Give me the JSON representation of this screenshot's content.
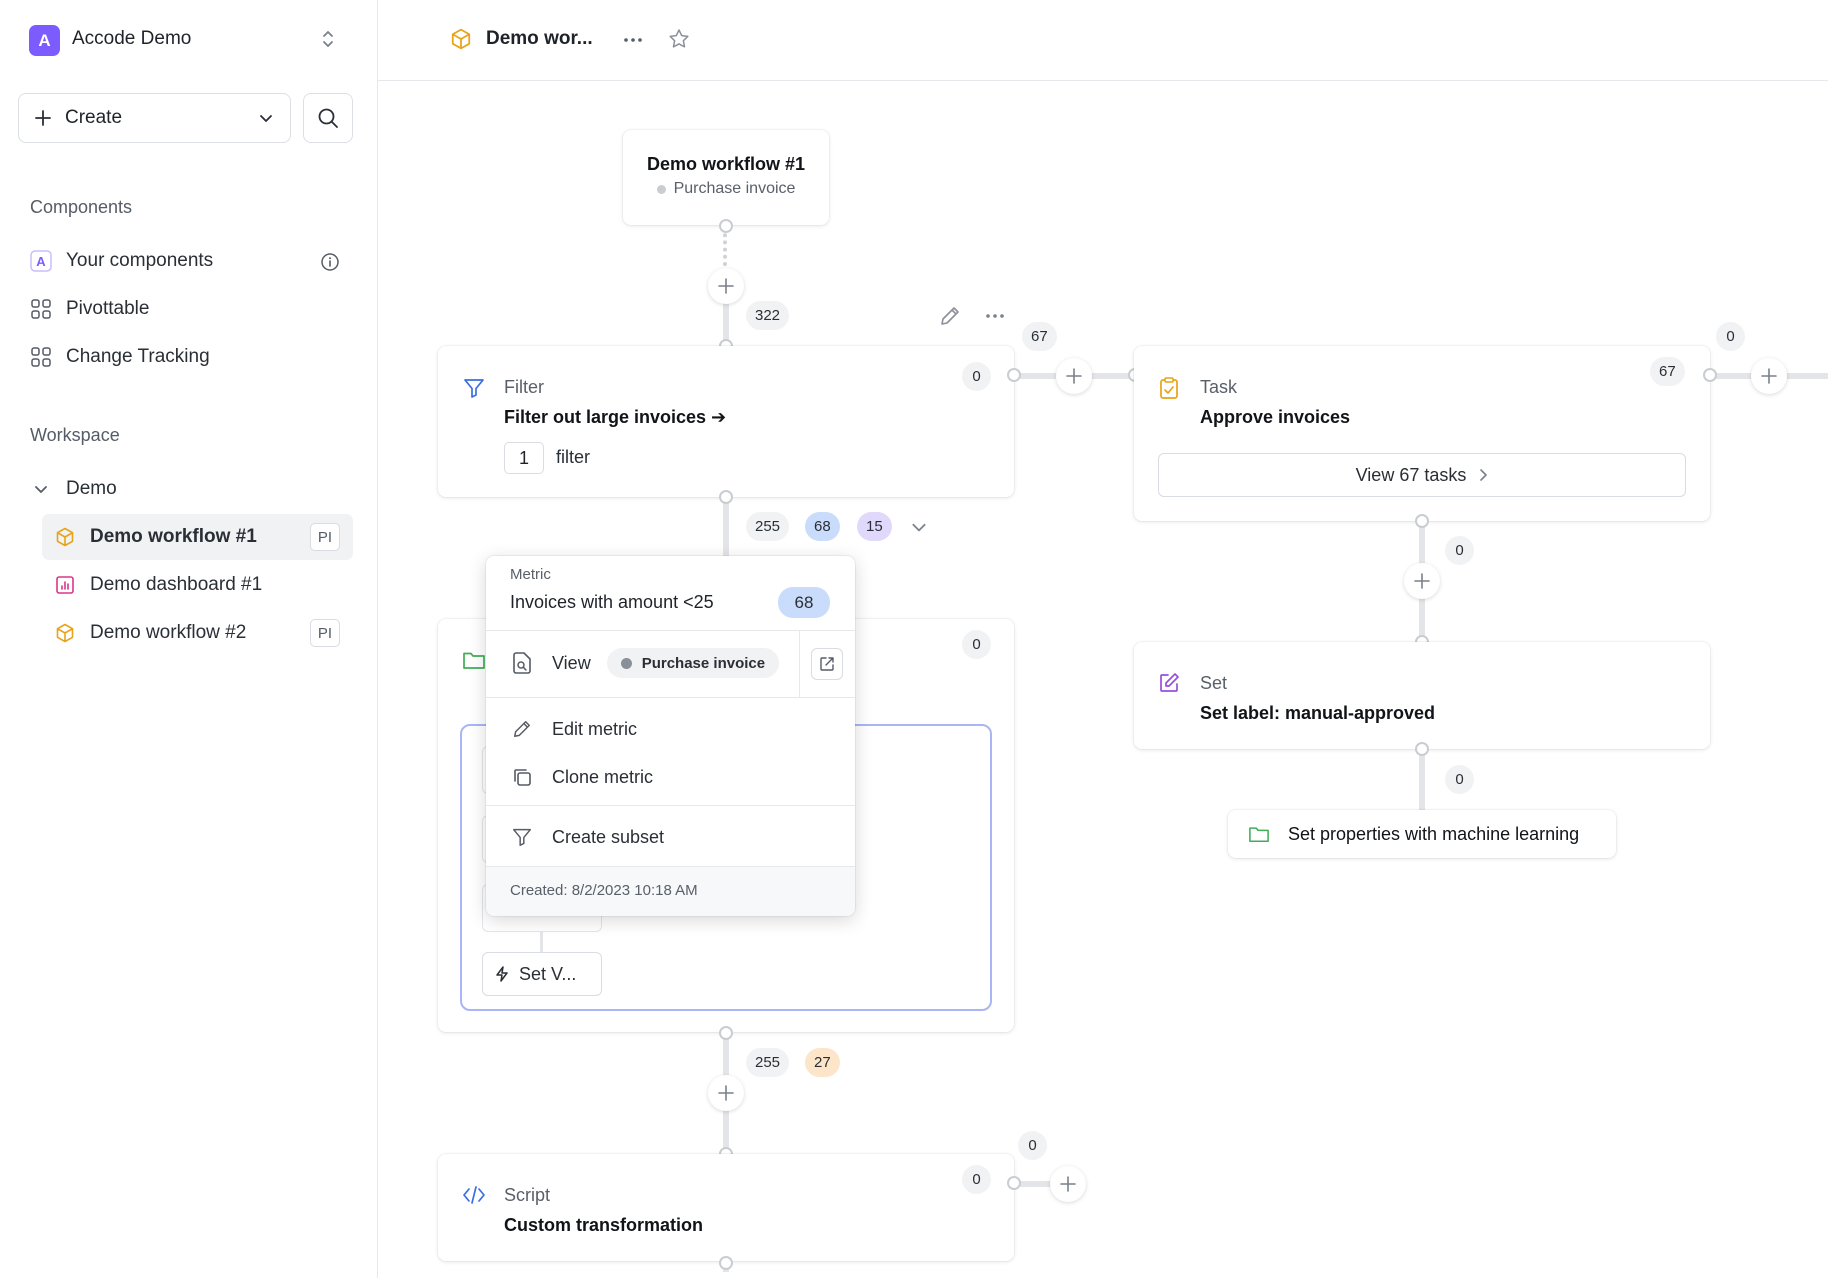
{
  "workspace": {
    "initial": "A",
    "name": "Accode Demo"
  },
  "sidebar": {
    "create_label": "Create",
    "components_title": "Components",
    "components": [
      {
        "label": "Your components"
      },
      {
        "label": "Pivottable"
      },
      {
        "label": "Change Tracking"
      }
    ],
    "workspace_title": "Workspace",
    "folder": "Demo",
    "items": [
      {
        "label": "Demo workflow #1",
        "badge": "PI"
      },
      {
        "label": "Demo dashboard #1"
      },
      {
        "label": "Demo workflow #2",
        "badge": "PI"
      }
    ]
  },
  "topbar": {
    "title": "Demo wor..."
  },
  "canvas": {
    "start": {
      "title": "Demo workflow #1",
      "subtitle": "Purchase invoice"
    },
    "edge_counts": {
      "start_out": "322",
      "filter_right": "67",
      "filter_right_zero": "0",
      "filter_out": "255",
      "filter_out_blue": "68",
      "filter_out_purple": "15",
      "task_right_count": "67",
      "task_right_zero": "0",
      "task_down": "0",
      "set_down": "0",
      "group_out": "255",
      "group_out_orange": "27",
      "script_right": "0",
      "script_zero": "0",
      "group_zero": "0"
    },
    "filter": {
      "type": "Filter",
      "name": "Filter out large invoices ➔",
      "count": "1",
      "count_label": "filter"
    },
    "task": {
      "type": "Task",
      "name": "Approve invoices",
      "button": "View 67 tasks"
    },
    "set": {
      "type": "Set",
      "name": "Set label: manual-approved"
    },
    "ml": {
      "label": "Set properties with machine learning"
    },
    "group": {
      "inner_label": "Set V..."
    },
    "script": {
      "type": "Script",
      "name": "Custom transformation"
    }
  },
  "popup": {
    "heading": "Metric",
    "title": "Invoices with amount <25",
    "count": "68",
    "view_label": "View",
    "view_chip": "Purchase invoice",
    "edit": "Edit metric",
    "clone": "Clone metric",
    "subset": "Create subset",
    "created": "Created: 8/2/2023 10:18 AM"
  },
  "colors": {
    "accent": "#7c5cff",
    "task": "#e8a317",
    "set": "#9b4ddb",
    "filter": "#3b6fe0",
    "folder": "#3fae57",
    "group_border": "#a9b6f5"
  }
}
